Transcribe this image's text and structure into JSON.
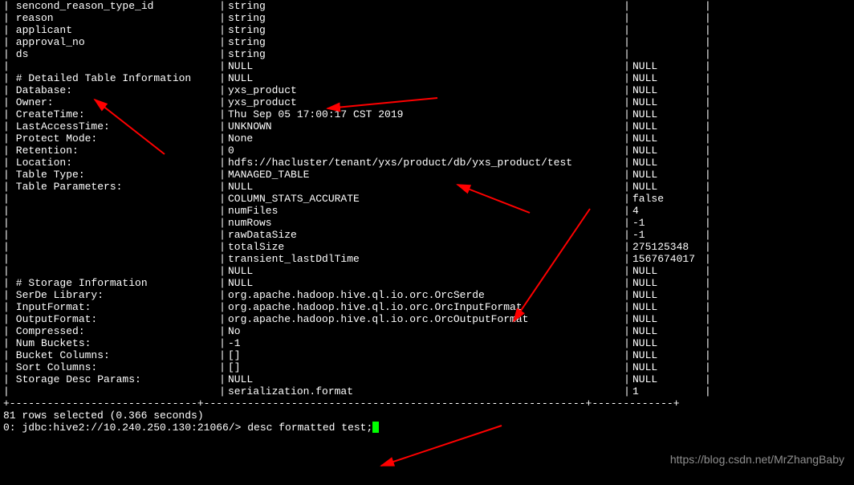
{
  "rows": [
    {
      "c1": " sencond_reason_type_id",
      "c2": "string",
      "c3": ""
    },
    {
      "c1": " reason",
      "c2": "string",
      "c3": ""
    },
    {
      "c1": " applicant",
      "c2": "string",
      "c3": ""
    },
    {
      "c1": " approval_no",
      "c2": "string",
      "c3": ""
    },
    {
      "c1": " ds",
      "c2": "string",
      "c3": ""
    },
    {
      "c1": "",
      "c2": "NULL",
      "c3": "NULL"
    },
    {
      "c1": " # Detailed Table Information",
      "c2": "NULL",
      "c3": "NULL"
    },
    {
      "c1": " Database:",
      "c2": "yxs_product",
      "c3": "NULL"
    },
    {
      "c1": " Owner:",
      "c2": "yxs_product",
      "c3": "NULL"
    },
    {
      "c1": " CreateTime:",
      "c2": "Thu Sep 05 17:00:17 CST 2019",
      "c3": "NULL"
    },
    {
      "c1": " LastAccessTime:",
      "c2": "UNKNOWN",
      "c3": "NULL"
    },
    {
      "c1": " Protect Mode:",
      "c2": "None",
      "c3": "NULL"
    },
    {
      "c1": " Retention:",
      "c2": "0",
      "c3": "NULL"
    },
    {
      "c1": " Location:",
      "c2": "hdfs://hacluster/tenant/yxs/product/db/yxs_product/test",
      "c3": "NULL"
    },
    {
      "c1": " Table Type:",
      "c2": "MANAGED_TABLE",
      "c3": "NULL"
    },
    {
      "c1": " Table Parameters:",
      "c2": "NULL",
      "c3": "NULL"
    },
    {
      "c1": "",
      "c2": "COLUMN_STATS_ACCURATE",
      "c3": "false"
    },
    {
      "c1": "",
      "c2": "numFiles",
      "c3": "4"
    },
    {
      "c1": "",
      "c2": "numRows",
      "c3": "-1"
    },
    {
      "c1": "",
      "c2": "rawDataSize",
      "c3": "-1"
    },
    {
      "c1": "",
      "c2": "totalSize",
      "c3": "275125348"
    },
    {
      "c1": "",
      "c2": "transient_lastDdlTime",
      "c3": "1567674017"
    },
    {
      "c1": "",
      "c2": "NULL",
      "c3": "NULL"
    },
    {
      "c1": " # Storage Information",
      "c2": "NULL",
      "c3": "NULL"
    },
    {
      "c1": " SerDe Library:",
      "c2": "org.apache.hadoop.hive.ql.io.orc.OrcSerde",
      "c3": "NULL"
    },
    {
      "c1": " InputFormat:",
      "c2": "org.apache.hadoop.hive.ql.io.orc.OrcInputFormat",
      "c3": "NULL"
    },
    {
      "c1": " OutputFormat:",
      "c2": "org.apache.hadoop.hive.ql.io.orc.OrcOutputFormat",
      "c3": "NULL"
    },
    {
      "c1": " Compressed:",
      "c2": "No",
      "c3": "NULL"
    },
    {
      "c1": " Num Buckets:",
      "c2": "-1",
      "c3": "NULL"
    },
    {
      "c1": " Bucket Columns:",
      "c2": "[]",
      "c3": "NULL"
    },
    {
      "c1": " Sort Columns:",
      "c2": "[]",
      "c3": "NULL"
    },
    {
      "c1": " Storage Desc Params:",
      "c2": "NULL",
      "c3": "NULL"
    },
    {
      "c1": "",
      "c2": "serialization.format",
      "c3": "1"
    }
  ],
  "sep": "+------------------------------+-------------------------------------------------------------+-------------+",
  "status": "81 rows selected (0.366 seconds)",
  "prompt_prefix": "0: jdbc:hive2://10.240.250.130:21066/> ",
  "prompt_command": "desc formatted test;",
  "watermark": "https://blog.csdn.net/MrZhangBaby"
}
